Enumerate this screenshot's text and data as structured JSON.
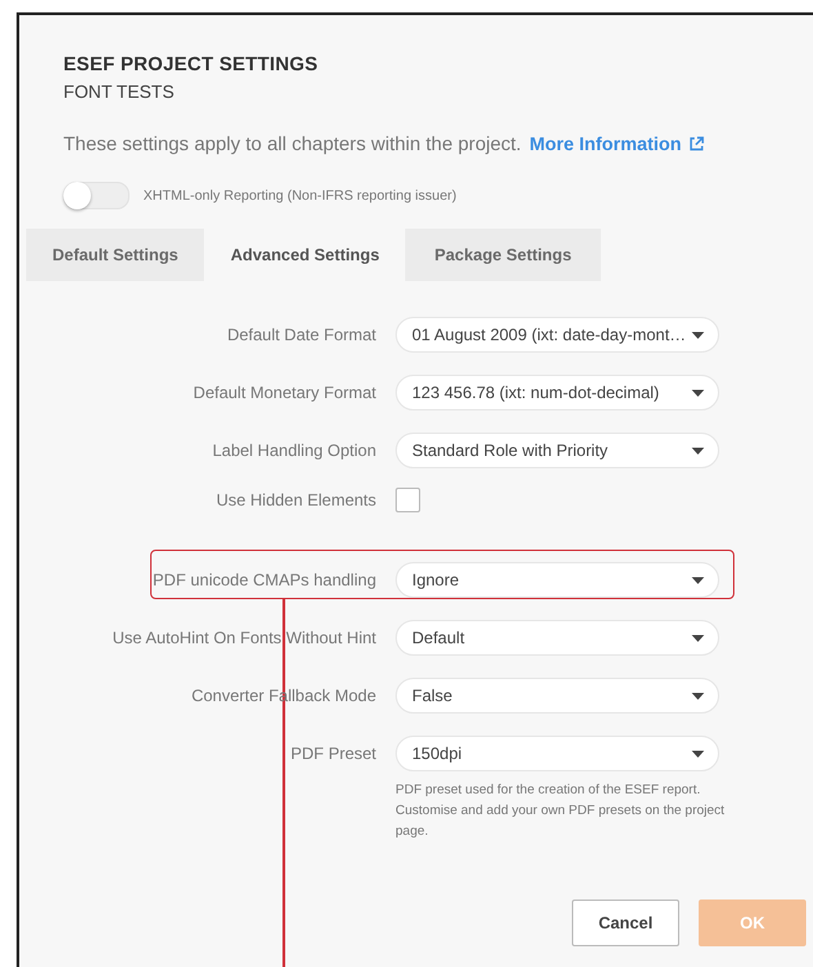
{
  "dialog": {
    "title": "ESEF PROJECT SETTINGS",
    "subtitle": "FONT TESTS",
    "description": "These settings apply to all chapters within the project.",
    "link": "More Information"
  },
  "toggle": {
    "label": "XHTML-only Reporting (Non-IFRS reporting issuer)",
    "on": false
  },
  "tabs": [
    {
      "label": "Default Settings",
      "selected": false
    },
    {
      "label": "Advanced Settings",
      "selected": true
    },
    {
      "label": "Package Settings",
      "selected": false
    }
  ],
  "settings": [
    {
      "kind": "select",
      "label": "Default Date Format",
      "value": "01 August 2009 (ixt: date-day-mont…",
      "highlighted": false
    },
    {
      "kind": "select",
      "label": "Default Monetary Format",
      "value": "123 456.78 (ixt: num-dot-decimal)",
      "highlighted": false
    },
    {
      "kind": "select",
      "label": "Label Handling Option",
      "value": "Standard Role with Priority",
      "highlighted": false
    },
    {
      "kind": "checkbox",
      "label": "Use Hidden Elements",
      "checked": false,
      "highlighted": false
    },
    {
      "kind": "select",
      "label": "PDF unicode CMAPs handling",
      "value": "Ignore",
      "highlighted": true
    },
    {
      "kind": "select",
      "label": "Use AutoHint On Fonts Without Hint",
      "value": "Default",
      "highlighted": false
    },
    {
      "kind": "select",
      "label": "Converter Fallback Mode",
      "value": "False",
      "highlighted": false
    },
    {
      "kind": "select",
      "label": "PDF Preset",
      "value": "150dpi",
      "highlighted": false,
      "help": "PDF preset used for the creation of the ESEF report. Customise and add your own PDF presets on the project page."
    }
  ],
  "buttons": [
    {
      "label": "Cancel",
      "kind": "secondary"
    },
    {
      "label": "OK",
      "kind": "primary"
    }
  ]
}
